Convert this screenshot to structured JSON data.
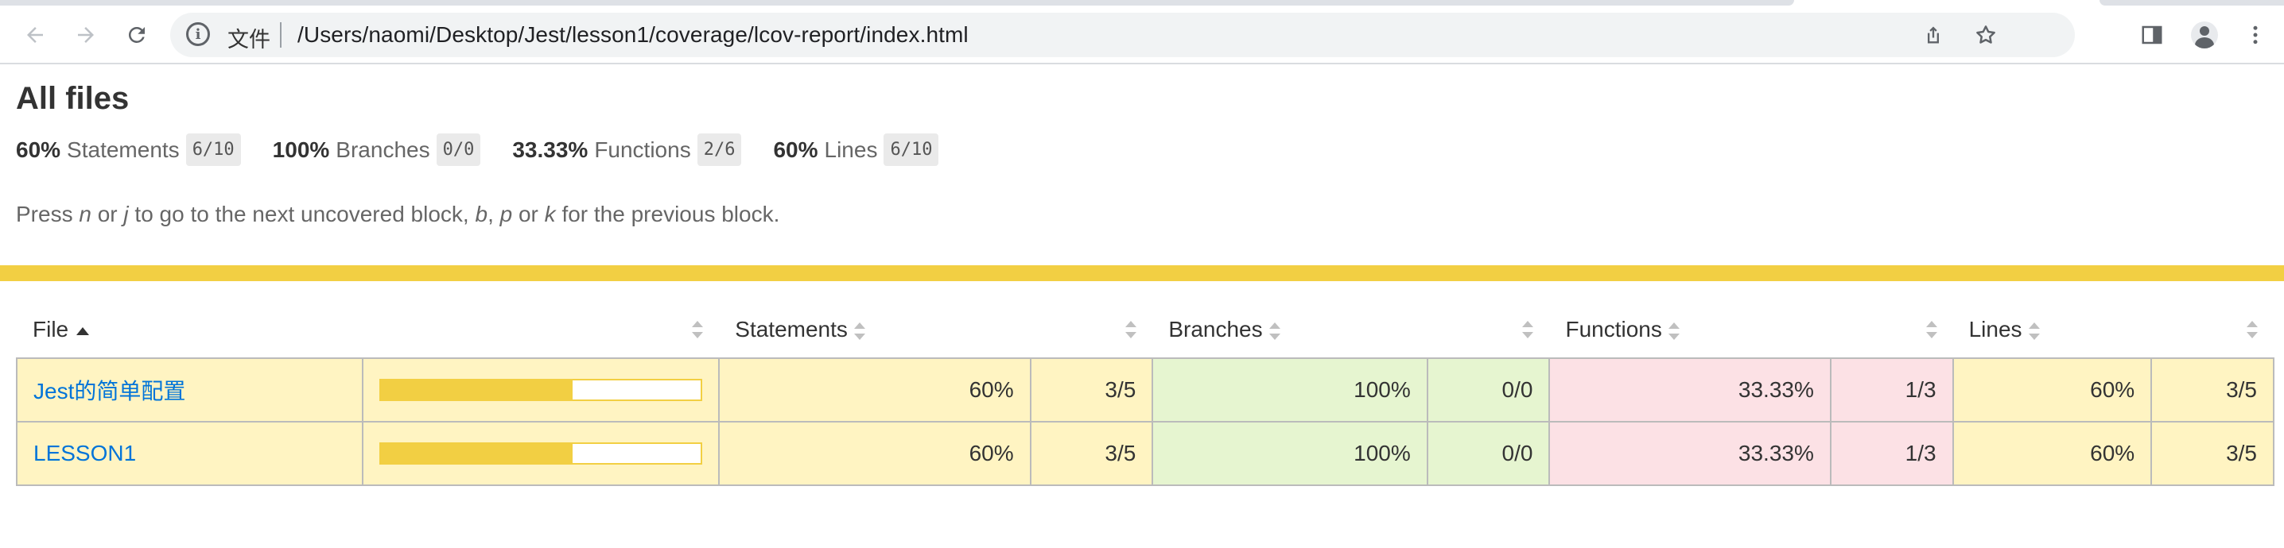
{
  "browser": {
    "back_icon": "arrow-left-icon",
    "forward_icon": "arrow-right-icon",
    "reload_icon": "reload-icon",
    "security_label": "文件",
    "url": "/Users/naomi/Desktop/Jest/lesson1/coverage/lcov-report/index.html",
    "icons": [
      "share-icon",
      "bookmark-star-icon",
      "side-panel-icon",
      "profile-avatar-icon",
      "more-vert-icon"
    ]
  },
  "page": {
    "title": "All files",
    "summary": [
      {
        "pct": "60%",
        "label": "Statements",
        "frac": "6/10"
      },
      {
        "pct": "100%",
        "label": "Branches",
        "frac": "0/0"
      },
      {
        "pct": "33.33%",
        "label": "Functions",
        "frac": "2/6"
      },
      {
        "pct": "60%",
        "label": "Lines",
        "frac": "6/10"
      }
    ],
    "hint": {
      "p1": "Press ",
      "k1": "n",
      "p2": " or ",
      "k2": "j",
      "p3": " to go to the next uncovered block, ",
      "k3": "b",
      "p4": ", ",
      "k4": "p",
      "p5": " or ",
      "k5": "k",
      "p6": " for the previous block."
    },
    "accent_color": "#f2cf43",
    "status_colors": {
      "medium": "#fff4c2",
      "high": "#e6f5d0",
      "low": "#fce1e5"
    }
  },
  "table": {
    "headers": {
      "file": "File",
      "statements": "Statements",
      "branches": "Branches",
      "functions": "Functions",
      "lines": "Lines"
    },
    "rows": [
      {
        "file": "Jest的简单配置",
        "coverage_fraction": 0.6,
        "statements_pct": "60%",
        "statements_frac": "3/5",
        "branches_pct": "100%",
        "branches_frac": "0/0",
        "functions_pct": "33.33%",
        "functions_frac": "1/3",
        "lines_pct": "60%",
        "lines_frac": "3/5"
      },
      {
        "file": "LESSON1",
        "coverage_fraction": 0.6,
        "statements_pct": "60%",
        "statements_frac": "3/5",
        "branches_pct": "100%",
        "branches_frac": "0/0",
        "functions_pct": "33.33%",
        "functions_frac": "1/3",
        "lines_pct": "60%",
        "lines_frac": "3/5"
      }
    ]
  }
}
